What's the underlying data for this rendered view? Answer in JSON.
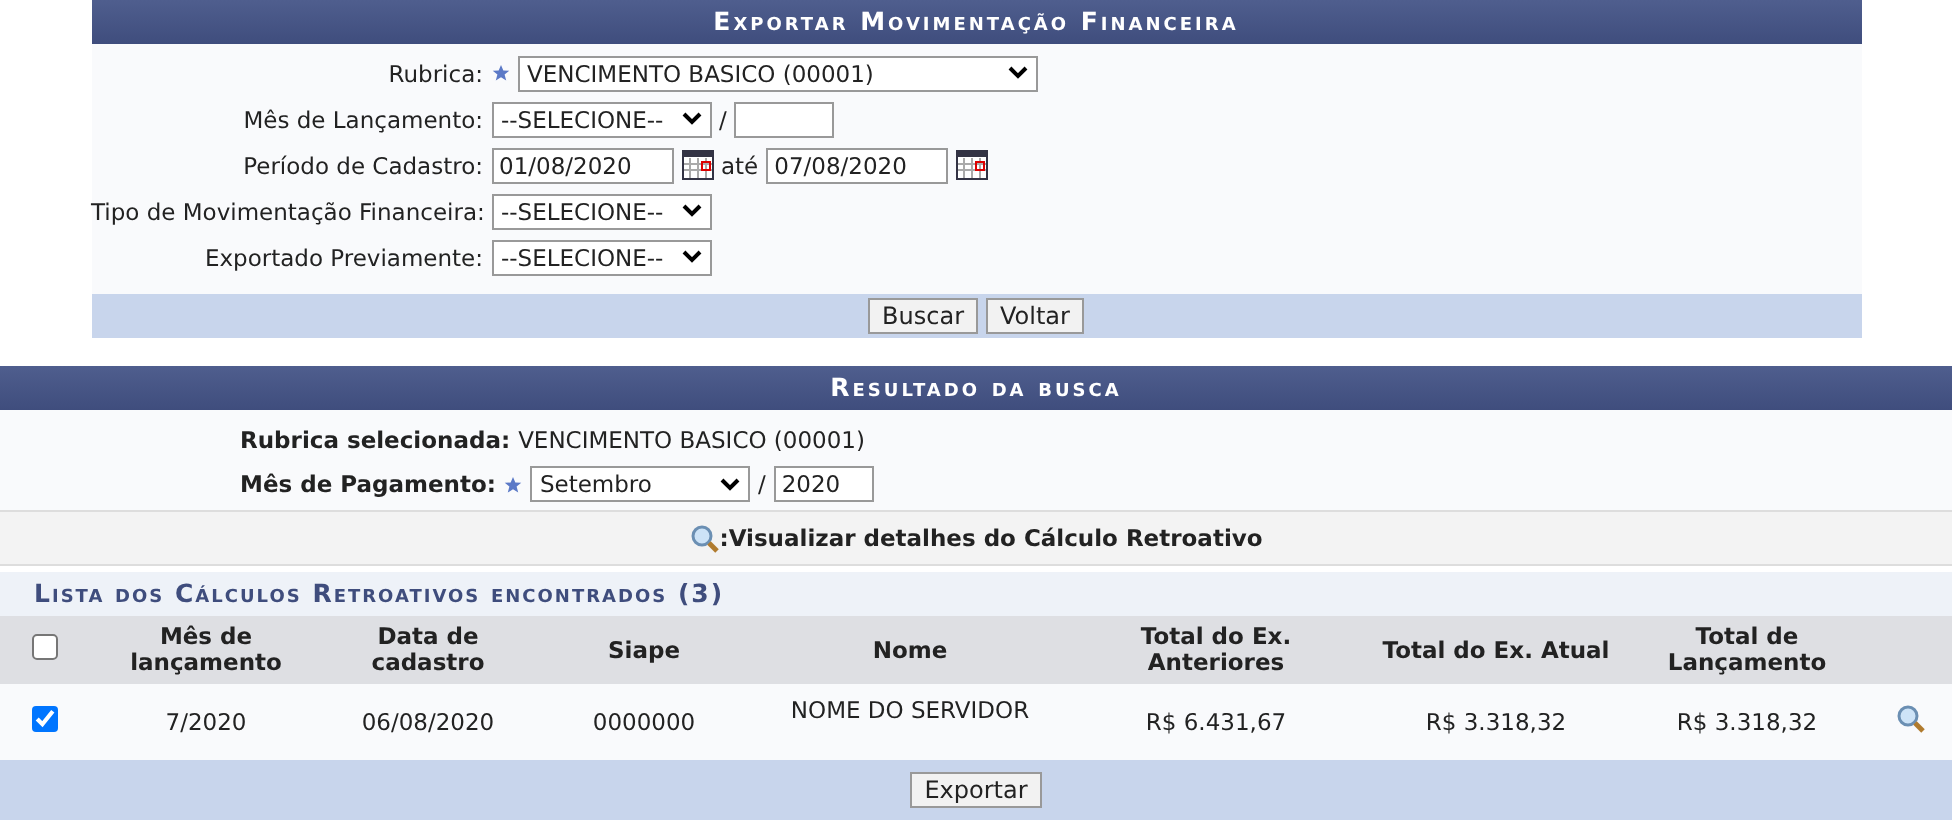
{
  "form": {
    "title": "Exportar Movimentação Financeira",
    "fields": [
      {
        "kind": "select",
        "label": "Rubrica:",
        "required": true,
        "value": "VENCIMENTO BASICO (00001)"
      },
      {
        "kind": "month",
        "label": "Mês de Lançamento:",
        "required": false,
        "value": "--SELECIONE--",
        "separator": "/"
      },
      {
        "kind": "period",
        "label": "Período de Cadastro:",
        "required": false,
        "from": "01/08/2020",
        "between": "até",
        "to": "07/08/2020"
      },
      {
        "kind": "select-short",
        "label": "Tipo de Movimentação Financeira:",
        "required": false,
        "value": "--SELECIONE--"
      },
      {
        "kind": "select-short",
        "label": "Exportado Previamente:",
        "required": false,
        "value": "--SELECIONE--"
      }
    ],
    "buttons": [
      "Buscar",
      "Voltar"
    ]
  },
  "result": {
    "title": "Resultado da busca",
    "rubrica_label": "Rubrica selecionada:",
    "rubrica_value": "VENCIMENTO BASICO (00001)",
    "pagamento_label": "Mês de Pagamento:",
    "pagamento_month": "Setembro",
    "pagamento_separator": "/",
    "pagamento_year": "2020",
    "legend": ":Visualizar detalhes do Cálculo Retroativo",
    "list_title": "Lista dos Cálculos Retroativos encontrados (3)",
    "select_all_checked": false,
    "columns": [
      "Mês de lançamento",
      "Data de cadastro",
      "Siape",
      "Nome",
      "Total do Ex. Anteriores",
      "Total do Ex. Atual",
      "Total de Lançamento"
    ],
    "rows": [
      {
        "checked": true,
        "cells": [
          "7/2020",
          "06/08/2020",
          "0000000",
          "NOME DO SERVIDOR",
          "R$ 6.431,67",
          "R$ 3.318,32",
          "R$ 3.318,32"
        ]
      }
    ],
    "button": "Exportar"
  }
}
